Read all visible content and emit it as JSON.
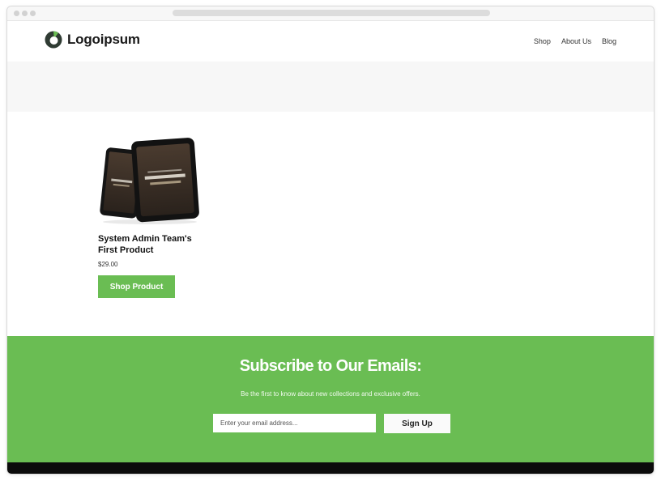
{
  "header": {
    "logo_text": "Logoipsum",
    "nav": [
      {
        "label": "Shop"
      },
      {
        "label": "About Us"
      },
      {
        "label": "Blog"
      }
    ]
  },
  "product": {
    "title": "System Admin Team's First Product",
    "price": "$29.00",
    "button_label": "Shop Product",
    "image_icon": "tablet-mockup-image"
  },
  "subscribe": {
    "title": "Subscribe to Our Emails:",
    "description": "Be the first to know about new collections and exclusive offers.",
    "email_placeholder": "Enter your email address...",
    "button_label": "Sign Up"
  },
  "colors": {
    "accent_green": "#6abd53",
    "footer_black": "#0b0b0b",
    "logo_dark": "#2f3b33"
  }
}
